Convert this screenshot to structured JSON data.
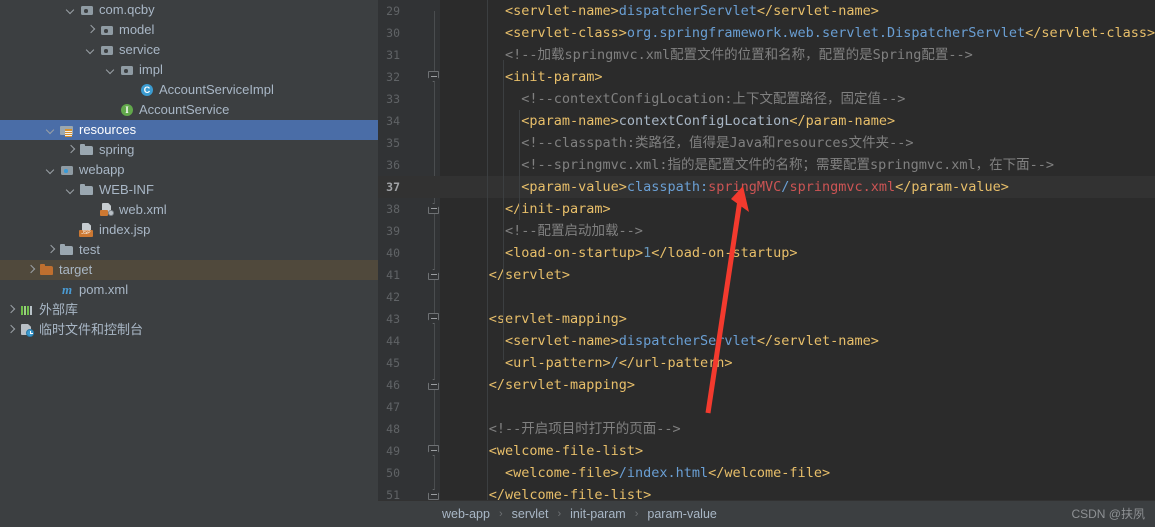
{
  "sidebar": {
    "items": [
      {
        "label": "com.qcby",
        "indent": 3,
        "arrow": "down",
        "icon": "package-icon",
        "state": "normal"
      },
      {
        "label": "model",
        "indent": 4,
        "arrow": "right",
        "icon": "package-icon",
        "state": "normal"
      },
      {
        "label": "service",
        "indent": 4,
        "arrow": "down",
        "icon": "package-icon",
        "state": "normal"
      },
      {
        "label": "impl",
        "indent": 5,
        "arrow": "down",
        "icon": "package-icon",
        "state": "normal"
      },
      {
        "label": "AccountServiceImpl",
        "indent": 6,
        "arrow": "none",
        "icon": "java-class-icon",
        "state": "normal"
      },
      {
        "label": "AccountService",
        "indent": 5,
        "arrow": "none",
        "icon": "java-interface-icon",
        "state": "normal"
      },
      {
        "label": "resources",
        "indent": 2,
        "arrow": "down",
        "icon": "resources-root-icon",
        "state": "selected"
      },
      {
        "label": "spring",
        "indent": 3,
        "arrow": "right",
        "icon": "folder-icon",
        "state": "normal"
      },
      {
        "label": "webapp",
        "indent": 2,
        "arrow": "down",
        "icon": "source-root-icon",
        "state": "normal"
      },
      {
        "label": "WEB-INF",
        "indent": 3,
        "arrow": "down",
        "icon": "folder-icon",
        "state": "normal"
      },
      {
        "label": "web.xml",
        "indent": 4,
        "arrow": "none",
        "icon": "xml-file-icon",
        "state": "normal"
      },
      {
        "label": "index.jsp",
        "indent": 3,
        "arrow": "none",
        "icon": "jsp-file-icon",
        "state": "normal"
      },
      {
        "label": "test",
        "indent": 2,
        "arrow": "right",
        "icon": "folder-icon",
        "state": "normal"
      },
      {
        "label": "target",
        "indent": 1,
        "arrow": "right",
        "icon": "folder-orange-icon",
        "state": "marked"
      },
      {
        "label": "pom.xml",
        "indent": 2,
        "arrow": "none",
        "icon": "maven-pom-icon",
        "state": "normal"
      },
      {
        "label": "外部库",
        "indent": 0,
        "arrow": "right",
        "icon": "external-libraries-icon",
        "state": "normal"
      },
      {
        "label": "临时文件和控制台",
        "indent": 0,
        "arrow": "right",
        "icon": "scratches-consoles-icon",
        "state": "normal"
      }
    ]
  },
  "editor": {
    "first_line_number": 29,
    "current_line_number": 37,
    "fold_lines": [
      32,
      38,
      41,
      43,
      46,
      49,
      51
    ],
    "lines": [
      {
        "n": 29,
        "indent": 8,
        "tokens": [
          {
            "t": "<servlet-name>",
            "c": "t-tag"
          },
          {
            "t": "dispatcherServlet",
            "c": "t-blue"
          },
          {
            "t": "</servlet-name>",
            "c": "t-tag"
          }
        ]
      },
      {
        "n": 30,
        "indent": 8,
        "tokens": [
          {
            "t": "<servlet-class>",
            "c": "t-tag"
          },
          {
            "t": "org.springframework.web.servlet.DispatcherServlet",
            "c": "t-blue"
          },
          {
            "t": "</servlet-class>",
            "c": "t-tag"
          }
        ]
      },
      {
        "n": 31,
        "indent": 8,
        "tokens": [
          {
            "t": "<!--加载springmvc.xml配置文件的位置和名称，配置的是Spring配置-->",
            "c": "t-cmt"
          }
        ]
      },
      {
        "n": 32,
        "indent": 8,
        "tokens": [
          {
            "t": "<init-param>",
            "c": "t-tag"
          }
        ]
      },
      {
        "n": 33,
        "indent": 10,
        "tokens": [
          {
            "t": "<!--contextConfigLocation:上下文配置路径，固定值-->",
            "c": "t-cmt"
          }
        ]
      },
      {
        "n": 34,
        "indent": 10,
        "tokens": [
          {
            "t": "<param-name>",
            "c": "t-tag"
          },
          {
            "t": "contextConfigLocation",
            "c": "t-txt"
          },
          {
            "t": "</param-name>",
            "c": "t-tag"
          }
        ]
      },
      {
        "n": 35,
        "indent": 10,
        "tokens": [
          {
            "t": "<!--classpath:类路径，值得是Java和resources文件夹-->",
            "c": "t-cmt"
          }
        ]
      },
      {
        "n": 36,
        "indent": 10,
        "tokens": [
          {
            "t": "<!--springmvc.xml:指的是配置文件的名称；需要配置springmvc.xml，在下面-->",
            "c": "t-cmt"
          }
        ]
      },
      {
        "n": 37,
        "indent": 10,
        "tokens": [
          {
            "t": "<param-value>",
            "c": "t-tag"
          },
          {
            "t": "classpath:",
            "c": "t-blue"
          },
          {
            "t": "springMVC",
            "c": "t-red"
          },
          {
            "t": "/",
            "c": "t-blue"
          },
          {
            "t": "springmvc.xml",
            "c": "t-red"
          },
          {
            "t": "</param-value>",
            "c": "t-tag"
          }
        ]
      },
      {
        "n": 38,
        "indent": 8,
        "tokens": [
          {
            "t": "</init-param>",
            "c": "t-tag"
          }
        ]
      },
      {
        "n": 39,
        "indent": 8,
        "tokens": [
          {
            "t": "<!--配置启动加载-->",
            "c": "t-cmt"
          }
        ]
      },
      {
        "n": 40,
        "indent": 8,
        "tokens": [
          {
            "t": "<load-on-startup>",
            "c": "t-tag"
          },
          {
            "t": "1",
            "c": "t-val"
          },
          {
            "t": "</load-on-startup>",
            "c": "t-tag"
          }
        ]
      },
      {
        "n": 41,
        "indent": 6,
        "tokens": [
          {
            "t": "</servlet>",
            "c": "t-tag"
          }
        ]
      },
      {
        "n": 42,
        "indent": 6,
        "tokens": []
      },
      {
        "n": 43,
        "indent": 6,
        "tokens": [
          {
            "t": "<servlet-mapping>",
            "c": "t-tag"
          }
        ]
      },
      {
        "n": 44,
        "indent": 8,
        "tokens": [
          {
            "t": "<servlet-name>",
            "c": "t-tag"
          },
          {
            "t": "dispatcherServlet",
            "c": "t-blue"
          },
          {
            "t": "</servlet-name>",
            "c": "t-tag"
          }
        ]
      },
      {
        "n": 45,
        "indent": 8,
        "tokens": [
          {
            "t": "<url-pattern>",
            "c": "t-tag"
          },
          {
            "t": "/",
            "c": "t-blue"
          },
          {
            "t": "</url-pattern>",
            "c": "t-tag"
          }
        ]
      },
      {
        "n": 46,
        "indent": 6,
        "tokens": [
          {
            "t": "</servlet-mapping>",
            "c": "t-tag"
          }
        ]
      },
      {
        "n": 47,
        "indent": 6,
        "tokens": []
      },
      {
        "n": 48,
        "indent": 6,
        "tokens": [
          {
            "t": "<!--开启项目时打开的页面-->",
            "c": "t-cmt"
          }
        ]
      },
      {
        "n": 49,
        "indent": 6,
        "tokens": [
          {
            "t": "<welcome-file-list>",
            "c": "t-tag"
          }
        ]
      },
      {
        "n": 50,
        "indent": 8,
        "tokens": [
          {
            "t": "<welcome-file>",
            "c": "t-tag"
          },
          {
            "t": "/index.html",
            "c": "t-blue"
          },
          {
            "t": "</welcome-file>",
            "c": "t-tag"
          }
        ]
      },
      {
        "n": 51,
        "indent": 6,
        "tokens": [
          {
            "t": "</welcome-file-list>",
            "c": "t-tag"
          }
        ]
      }
    ]
  },
  "breadcrumb": {
    "separator": "›",
    "items": [
      "web-app",
      "servlet",
      "init-param",
      "param-value"
    ]
  },
  "watermark": "CSDN @扶夙",
  "colors": {
    "selection_blue": "#4a6da7",
    "marked_row": "#50493c",
    "editor_bg": "#2b2b2b",
    "panel_bg": "#3c3f41",
    "gutter_bg": "#313335",
    "arrow_red": "#f33a2e",
    "tag_yellow": "#e8bf6a",
    "comment_gray": "#808080",
    "value_blue": "#6a9fd4",
    "string_red": "#cc5454"
  }
}
